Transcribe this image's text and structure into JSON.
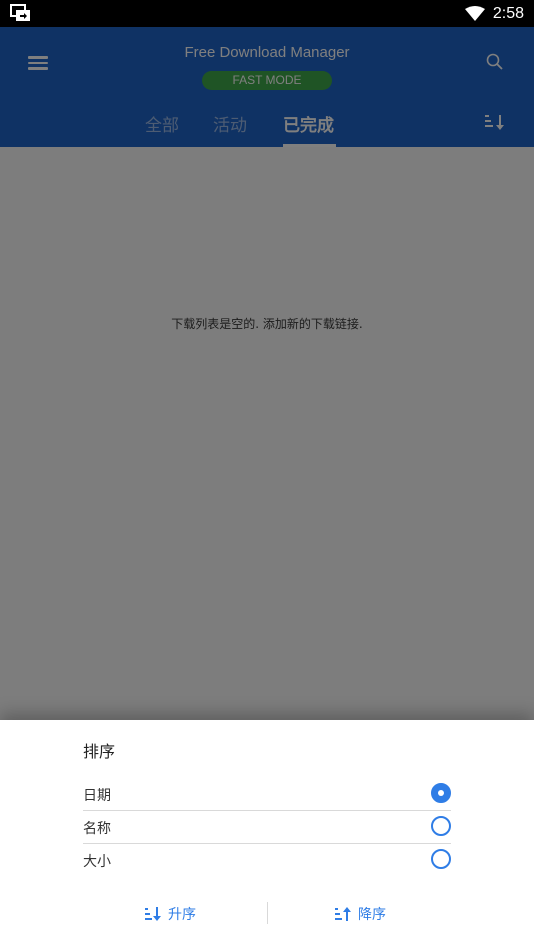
{
  "status_bar": {
    "time": "2:58"
  },
  "app": {
    "title": "Free Download Manager",
    "mode_badge": "FAST MODE",
    "tabs": [
      {
        "label": "全部"
      },
      {
        "label": "活动"
      },
      {
        "label": "已完成"
      }
    ],
    "empty_message": "下载列表是空的. 添加新的下载链接."
  },
  "sort_sheet": {
    "title": "排序",
    "options": [
      {
        "label": "日期",
        "selected": true
      },
      {
        "label": "名称",
        "selected": false
      },
      {
        "label": "大小",
        "selected": false
      }
    ],
    "ascending_label": "升序",
    "descending_label": "降序"
  },
  "colors": {
    "appbar": "#1f64c8",
    "accent": "#2f7de6",
    "badge": "#3fa84a"
  },
  "icons": [
    "screen-cast-icon",
    "wifi-icon",
    "battery-icon",
    "menu-icon",
    "search-icon",
    "sort-icon",
    "sort-ascending-icon",
    "sort-descending-icon"
  ]
}
